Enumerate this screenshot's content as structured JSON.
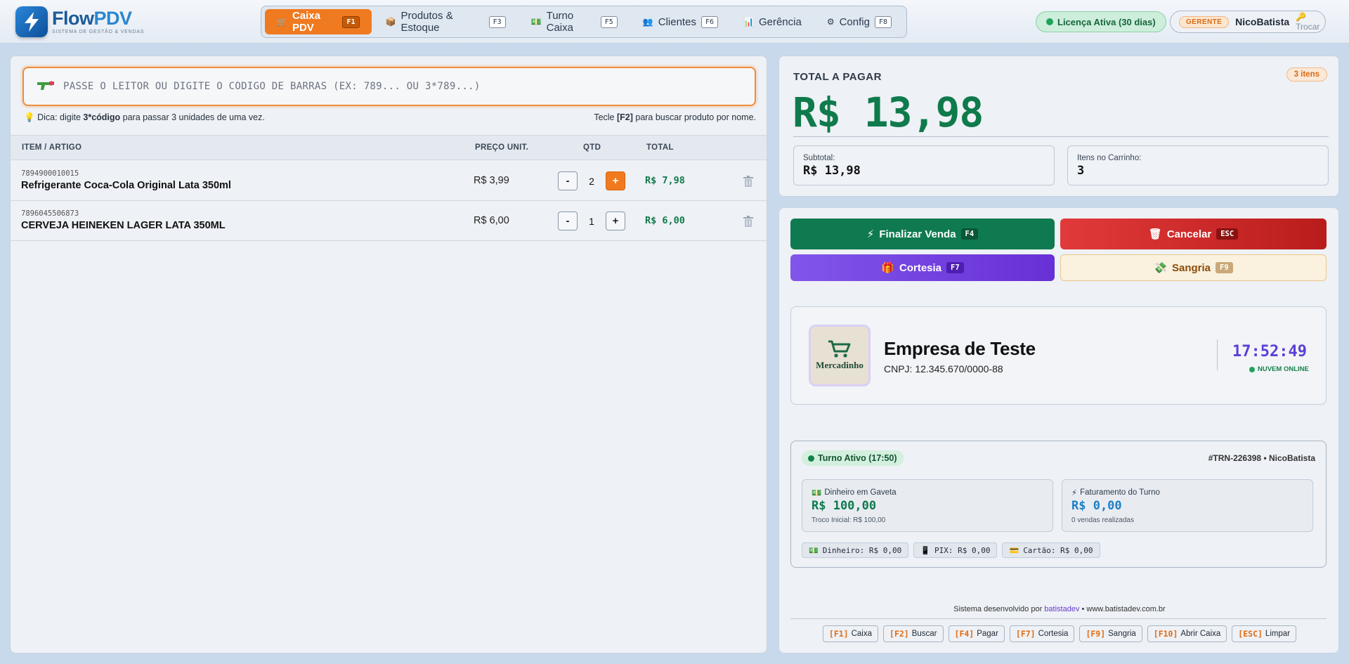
{
  "brand": {
    "name_a": "Flow",
    "name_b": "PDV",
    "tagline": "SISTEMA DE GESTÃO & VENDAS"
  },
  "nav": [
    {
      "label": "Caixa PDV",
      "key": "F1",
      "icon": "cash-register-icon",
      "active": true
    },
    {
      "label": "Produtos & Estoque",
      "key": "F3",
      "icon": "box-icon"
    },
    {
      "label": "Turno Caixa",
      "key": "F5",
      "icon": "money-icon"
    },
    {
      "label": "Clientes",
      "key": "F6",
      "icon": "users-icon"
    },
    {
      "label": "Gerência",
      "key": "",
      "icon": "chart-icon"
    },
    {
      "label": "Config",
      "key": "F8",
      "icon": "gear-icon"
    }
  ],
  "license": {
    "label": "Licença Ativa (30 dias)"
  },
  "user": {
    "role": "GERENTE",
    "name": "NicoBatista",
    "switch_label": "Trocar"
  },
  "scanner": {
    "placeholder": "PASSE O LEITOR OU DIGITE O CÓDIGO DE BARRAS (EX: 789... OU 3*789...)"
  },
  "hint": {
    "prefix": "Dica: digite ",
    "bold": "3*código",
    "suffix": " para passar 3 unidades de uma vez.",
    "right_prefix": "Tecle ",
    "right_bold": "[F2]",
    "right_suffix": " para buscar produto por nome."
  },
  "table": {
    "headers": {
      "item": "ITEM / ARTIGO",
      "price": "PREÇO UNIT.",
      "qty": "QTD",
      "total": "TOTAL"
    },
    "rows": [
      {
        "code": "7894900010015",
        "name": "Refrigerante Coca-Cola Original Lata 350ml",
        "price": "R$ 3,99",
        "qty": "2",
        "total": "R$ 7,98"
      },
      {
        "code": "7896045506873",
        "name": "CERVEJA HEINEKEN LAGER LATA 350ML",
        "price": "R$ 6,00",
        "qty": "1",
        "total": "R$ 6,00"
      }
    ]
  },
  "summary": {
    "label": "TOTAL A PAGAR",
    "items_badge": "3 itens",
    "total": "R$ 13,98",
    "subtotal_label": "Subtotal:",
    "subtotal": "R$ 13,98",
    "cart_label": "Itens no Carrinho:",
    "cart_count": "3"
  },
  "actions": {
    "finish": {
      "label": "Finalizar Venda",
      "key": "F4"
    },
    "cancel": {
      "label": "Cancelar",
      "key": "ESC"
    },
    "courtesy": {
      "label": "Cortesia",
      "key": "F7"
    },
    "sangria": {
      "label": "Sangria",
      "key": "F9"
    }
  },
  "company": {
    "logo_text": "Mercadinho",
    "name": "Empresa de Teste",
    "cnpj": "CNPJ: 12.345.670/0000-88",
    "clock": "17:52:49",
    "status": "NUVEM ONLINE"
  },
  "shift": {
    "badge": "Turno Ativo (17:50)",
    "id": "#TRN-226398 • NicoBatista",
    "drawer_label": "Dinheiro em Gaveta",
    "drawer_value": "R$ 100,00",
    "drawer_note": "Troco Inicial: R$ 100,00",
    "revenue_label": "Faturamento do Turno",
    "revenue_value": "R$ 0,00",
    "revenue_note": "0 vendas realizadas",
    "payments": [
      {
        "label": "Dinheiro: R$ 0,00",
        "icon": "cash-icon"
      },
      {
        "label": "PIX: R$ 0,00",
        "icon": "pix-icon"
      },
      {
        "label": "Cartão: R$ 0,00",
        "icon": "card-icon"
      }
    ]
  },
  "footer": {
    "credit_prefix": "Sistema desenvolvido por ",
    "credit_brand": "batistadev",
    "credit_suffix": " • www.batistadev.com.br",
    "shortcuts": [
      {
        "key": "[F1]",
        "label": "Caixa"
      },
      {
        "key": "[F2]",
        "label": "Buscar"
      },
      {
        "key": "[F4]",
        "label": "Pagar"
      },
      {
        "key": "[F7]",
        "label": "Cortesia"
      },
      {
        "key": "[F9]",
        "label": "Sangria"
      },
      {
        "key": "[F10]",
        "label": "Abrir Caixa"
      },
      {
        "key": "[ESC]",
        "label": "Limpar"
      }
    ]
  },
  "colors": {
    "accent": "#f07a1f",
    "success": "#0f7a4c",
    "danger": "#d32f2f",
    "purple": "#6d3be0"
  }
}
